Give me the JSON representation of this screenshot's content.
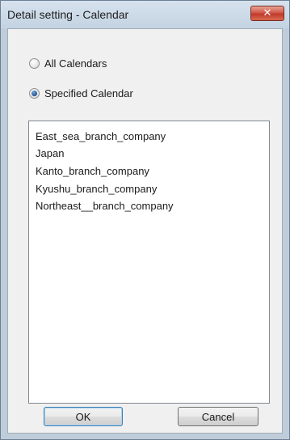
{
  "window": {
    "title": "Detail setting - Calendar",
    "close_icon": "close-icon"
  },
  "options": {
    "all_calendars": {
      "label": "All Calendars",
      "selected": false
    },
    "specified_calendar": {
      "label": "Specified Calendar",
      "selected": true
    }
  },
  "calendar_list": {
    "items": [
      "East_sea_branch_company",
      "Japan",
      "Kanto_branch_company",
      "Kyushu_branch_company",
      "Northeast__branch_company"
    ]
  },
  "buttons": {
    "ok_label": "OK",
    "cancel_label": "Cancel"
  },
  "colors": {
    "close_button": "#c0392b",
    "radio_selected": "#1f4f8f",
    "default_button_border": "#3c7fb1"
  }
}
